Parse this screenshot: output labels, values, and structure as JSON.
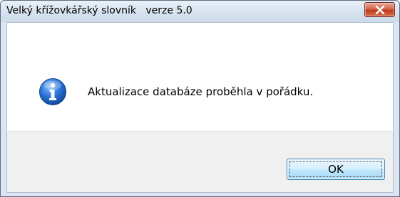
{
  "window": {
    "title": "Velký křížovkářský slovník   verze 5.0",
    "close_icon": "close-icon"
  },
  "message": {
    "icon": "info-icon",
    "text": "Aktualizace databáze proběhla v pořádku."
  },
  "buttons": {
    "ok_label": "OK"
  },
  "colors": {
    "close_button": "#c1391c",
    "info_icon": "#1d5fb8",
    "ok_border": "#3c7fb1"
  }
}
